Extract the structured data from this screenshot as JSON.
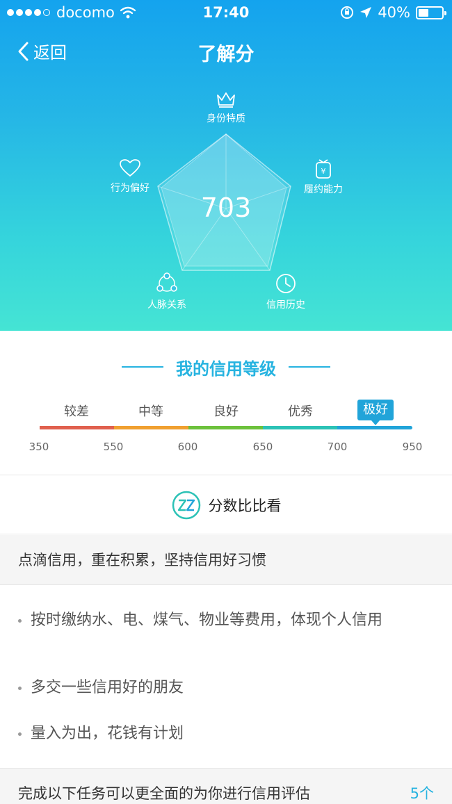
{
  "status_bar": {
    "carrier": "docomo",
    "time": "17:40",
    "battery": "40%"
  },
  "nav": {
    "back_label": "返回",
    "title": "了解分"
  },
  "radar": {
    "score": "703",
    "dimensions": {
      "identity": "身份特质",
      "fulfillment": "履约能力",
      "history": "信用历史",
      "connections": "人脉关系",
      "behavior": "行为偏好"
    }
  },
  "level": {
    "title": "我的信用等级",
    "grades": [
      "较差",
      "中等",
      "良好",
      "优秀",
      "极好"
    ],
    "active_grade": "极好",
    "ticks": [
      "350",
      "550",
      "600",
      "650",
      "700",
      "950"
    ],
    "bar_colors": [
      "#e0604e",
      "#f0a030",
      "#6cc13c",
      "#2cc2b6",
      "#21a4d9"
    ]
  },
  "compare": {
    "label": "分数比比看"
  },
  "tips": {
    "header": "点滴信用，重在积累，坚持信用好习惯",
    "items": [
      "按时缴纳水、电、煤气、物业等费用，体现个人信用",
      "多交一些信用好的朋友",
      "量入为出，花钱有计划"
    ]
  },
  "tasks": {
    "text": "完成以下任务可以更全面的为你进行信用评估",
    "count": "5个"
  },
  "colors": {
    "accent": "#26b3e0",
    "hero_top": "#14a3ee",
    "hero_bottom": "#45e4d4"
  }
}
